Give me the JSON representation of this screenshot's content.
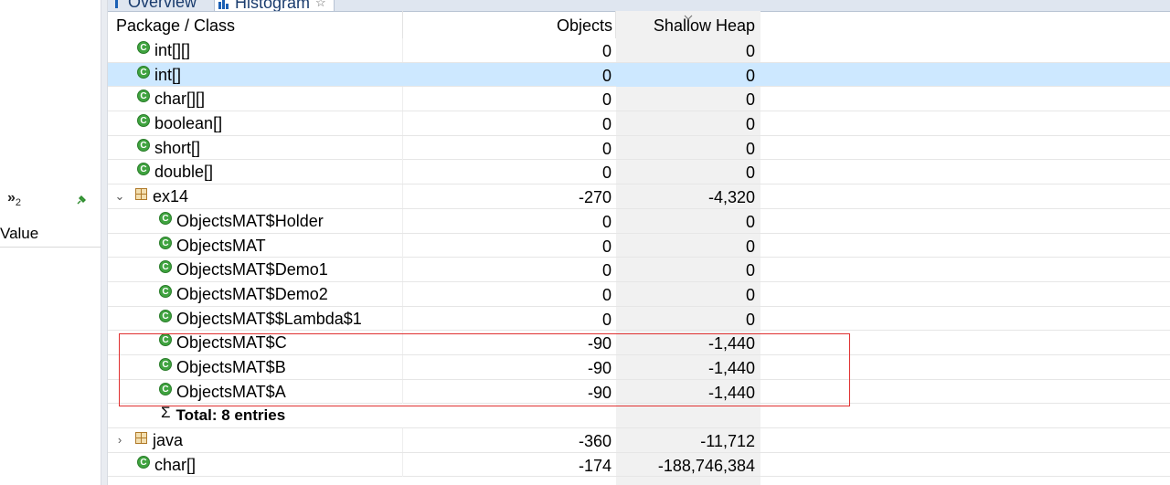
{
  "left_panel": {
    "chevron": "»",
    "chevron_count": "2",
    "value_label": "Value"
  },
  "tabs": [
    {
      "label": "Overview"
    },
    {
      "label": "Histogram",
      "close": "☆"
    }
  ],
  "table": {
    "headers": {
      "package_class": "Package / Class",
      "objects": "Objects",
      "shallow_heap": "Shallow Heap"
    },
    "rows": [
      {
        "name": "int[][]",
        "objects": "0",
        "shallow": "0"
      },
      {
        "name": "int[]",
        "objects": "0",
        "shallow": "0"
      },
      {
        "name": "char[][]",
        "objects": "0",
        "shallow": "0"
      },
      {
        "name": "boolean[]",
        "objects": "0",
        "shallow": "0"
      },
      {
        "name": "short[]",
        "objects": "0",
        "shallow": "0"
      },
      {
        "name": "double[]",
        "objects": "0",
        "shallow": "0"
      },
      {
        "name": "ex14",
        "objects": "-270",
        "shallow": "-4,320"
      },
      {
        "name": "ObjectsMAT$Holder",
        "objects": "0",
        "shallow": "0"
      },
      {
        "name": "ObjectsMAT",
        "objects": "0",
        "shallow": "0"
      },
      {
        "name": "ObjectsMAT$Demo1",
        "objects": "0",
        "shallow": "0"
      },
      {
        "name": "ObjectsMAT$Demo2",
        "objects": "0",
        "shallow": "0"
      },
      {
        "name": "ObjectsMAT$$Lambda$1",
        "objects": "0",
        "shallow": "0"
      },
      {
        "name": "ObjectsMAT$C",
        "objects": "-90",
        "shallow": "-1,440"
      },
      {
        "name": "ObjectsMAT$B",
        "objects": "-90",
        "shallow": "-1,440"
      },
      {
        "name": "ObjectsMAT$A",
        "objects": "-90",
        "shallow": "-1,440"
      },
      {
        "name": "Total: 8 entries",
        "objects": "",
        "shallow": ""
      },
      {
        "name": "java",
        "objects": "-360",
        "shallow": "-11,712"
      },
      {
        "name": "char[]",
        "objects": "-174",
        "shallow": "-188,746,384"
      }
    ],
    "class_icon_letter": "C",
    "sigma": "Σ",
    "expanded_glyph": "⌄",
    "collapsed_glyph": "›"
  },
  "colors": {
    "selection": "#cde8ff",
    "class_icon": "#3fa33f",
    "highlight_border": "#e03030",
    "shallow_column_bg": "#f1f1f1"
  }
}
